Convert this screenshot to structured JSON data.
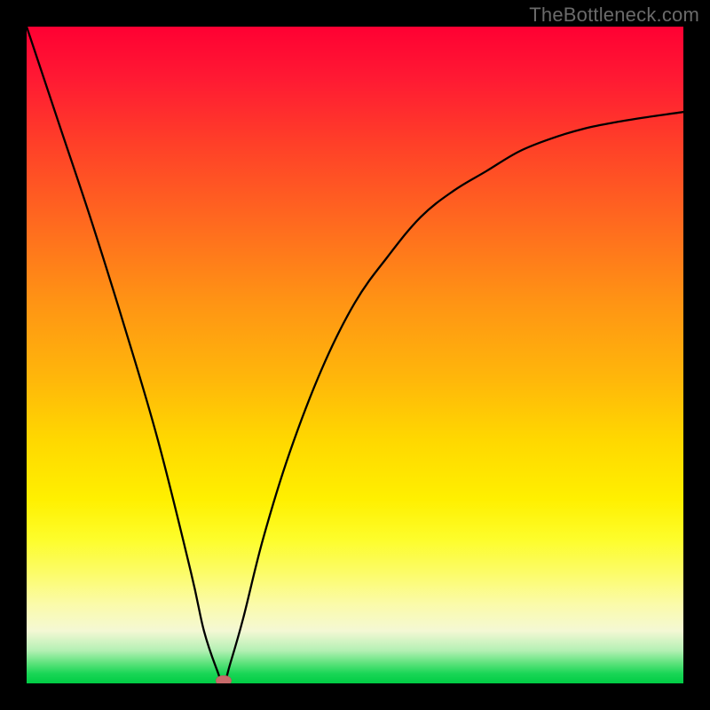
{
  "watermark": "TheBottleneck.com",
  "chart_data": {
    "type": "line",
    "title": "",
    "xlabel": "",
    "ylabel": "",
    "xlim": [
      0,
      100
    ],
    "ylim": [
      0,
      100
    ],
    "grid": false,
    "legend": false,
    "background_gradient": {
      "top_color": "#ff0033",
      "mid_color": "#ffd800",
      "bottom_color": "#00cc44",
      "meaning": "red=high bottleneck, green=no bottleneck"
    },
    "series": [
      {
        "name": "bottleneck-curve",
        "x": [
          0,
          5,
          10,
          15,
          20,
          25,
          27,
          29,
          30,
          31,
          33,
          36,
          40,
          45,
          50,
          55,
          60,
          65,
          70,
          75,
          80,
          85,
          90,
          95,
          100
        ],
        "values": [
          100,
          85,
          70,
          54,
          37,
          17,
          8,
          2,
          0,
          3,
          10,
          22,
          35,
          48,
          58,
          65,
          71,
          75,
          78,
          81,
          83,
          84.5,
          85.5,
          86.3,
          87
        ]
      }
    ],
    "minimum_point": {
      "x": 30,
      "y": 0
    },
    "marker_color": "#c76a6a"
  }
}
